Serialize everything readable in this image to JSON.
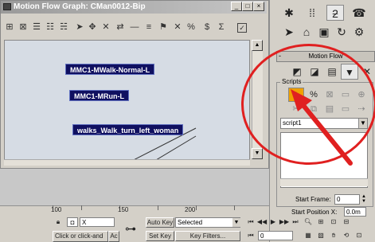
{
  "motion_flow_window": {
    "title": "Motion Flow Graph: CMan0012-Bip",
    "window_buttons": [
      "_",
      "□",
      "×"
    ],
    "nodes": [
      "MMC1-MWalk-Normal-L",
      "MMC1-MRun-L",
      "walks_Walk_turn_left_woman"
    ]
  },
  "right_panel": {
    "rollout_title": "Motion Flow",
    "scripts_group_label": "Scripts",
    "script_dropdown_value": "script1",
    "start_frame_label": "Start Frame:",
    "start_frame_value": "0",
    "start_position_label": "Start Position X:",
    "start_position_value": "0.0m"
  },
  "timeline": {
    "ruler_labels": [
      "100",
      "150",
      "200"
    ],
    "x_field_prefix": "X",
    "status_prompt": "Click or click-and",
    "status_prompt_2": "Ac",
    "auto_key_label": "Auto Key",
    "selected_dropdown": "Selected",
    "set_key_label": "Set Key",
    "key_filters_label": "Key Filters...",
    "frame_value": "0"
  },
  "annotation": {
    "circle_color": "#e02020",
    "arrow_color": "#e02020"
  }
}
